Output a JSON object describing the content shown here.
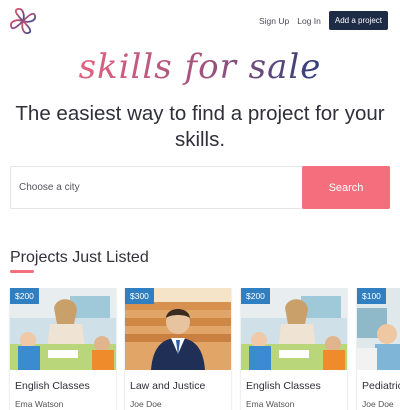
{
  "header": {
    "logo_icon": "interlocking-loops-logo-icon",
    "nav": {
      "sign_up": "Sign Up",
      "log_in": "Log In",
      "add_project": "Add a project"
    }
  },
  "hero": {
    "script_title": "skills for sale",
    "tagline": "The easiest way to find a project for your skills."
  },
  "search": {
    "placeholder": "Choose a city",
    "button": "Search"
  },
  "section": {
    "title": "Projects Just Listed"
  },
  "colors": {
    "accent": "#f46e7d",
    "navy": "#1e2b46",
    "price_badge": "#2f7fc1"
  },
  "cards": [
    {
      "price": "$200",
      "title": "English Classes",
      "author": "Ema Watson",
      "image": "classroom-image"
    },
    {
      "price": "$300",
      "title": "Law and Justice",
      "author": "Joe Doe",
      "image": "businessman-image"
    },
    {
      "price": "$200",
      "title": "English Classes",
      "author": "Ema Watson",
      "image": "classroom-image"
    },
    {
      "price": "$100",
      "title": "Pediatrics",
      "author": "Joe Doe",
      "image": "pediatrics-image"
    }
  ]
}
